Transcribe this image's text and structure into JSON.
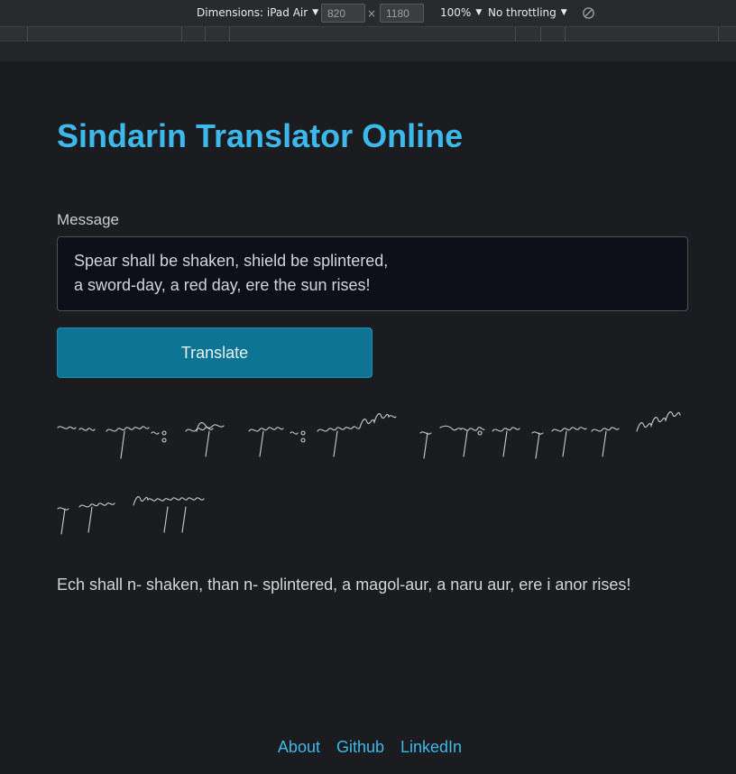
{
  "devtools": {
    "dimensions_label": "Dimensions: iPad Air",
    "width_value": "820",
    "height_value": "1180",
    "times_sign": "×",
    "zoom": "100%",
    "throttling": "No throttling",
    "caret": "▼",
    "rotate_icon": "rotate-icon"
  },
  "page": {
    "title": "Sindarin Translator Online",
    "message_label": "Message",
    "message_value": "Spear shall be shaken, shield be splintered,\na sword-day, a red day, ere the sun rises!",
    "translate_button": "Translate",
    "output_text": "Ech shall n- shaken, than n- splintered, a magol-aur, a naru aur, ere i anor rises!",
    "footer_links": [
      "About",
      "Github",
      "LinkedIn"
    ]
  },
  "colors": {
    "accent": "#3db8ea",
    "button": "#0e7493",
    "background": "#1b1c1f"
  }
}
